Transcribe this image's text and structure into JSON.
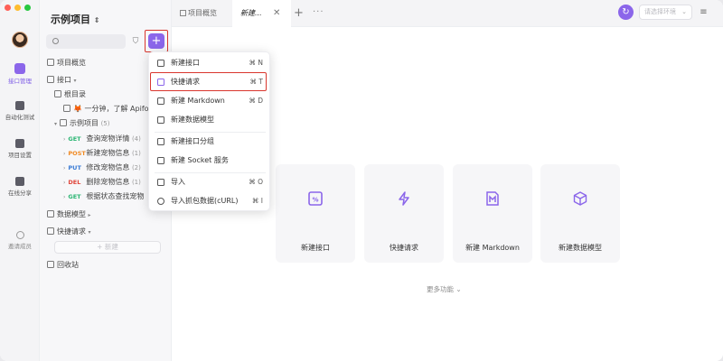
{
  "project": {
    "title": "示例项目"
  },
  "rail": {
    "items": [
      {
        "label": "接口管理",
        "active": true
      },
      {
        "label": "自动化测试"
      },
      {
        "label": "项目设置"
      },
      {
        "label": "在线分享"
      },
      {
        "label": "邀请成员"
      }
    ]
  },
  "sidebar": {
    "overview": "项目概览",
    "interfaces": "接口",
    "root": "根目录",
    "apifox_intro": "🦊 一分钟，了解 Apifox !",
    "sample_group": "示例项目",
    "sample_group_count": "(5)",
    "endpoints": [
      {
        "method": "GET",
        "name": "查询宠物详情",
        "count": "(4)"
      },
      {
        "method": "POST",
        "name": "新建宠物信息",
        "count": "(1)"
      },
      {
        "method": "PUT",
        "name": "修改宠物信息",
        "count": "(2)"
      },
      {
        "method": "DEL",
        "name": "删除宠物信息",
        "count": "(1)"
      },
      {
        "method": "GET",
        "name": "根据状态查找宠物",
        "count": ""
      }
    ],
    "data_models": "数据模型",
    "quick_requests": "快捷请求",
    "new_button": "+ 新建",
    "trash": "回收站"
  },
  "tabs": [
    {
      "label": "项目概览"
    },
    {
      "label": "新建...",
      "active": true
    }
  ],
  "toolbar": {
    "env_placeholder": "请选择环境"
  },
  "dropdown": {
    "items": [
      {
        "label": "新建接口",
        "shortcut": "⌘ N"
      },
      {
        "label": "快捷请求",
        "shortcut": "⌘ T",
        "highlighted": true
      },
      {
        "label": "新建 Markdown",
        "shortcut": "⌘ D"
      },
      {
        "label": "新建数据模型",
        "shortcut": ""
      },
      {
        "label": "新建接口分组",
        "shortcut": ""
      },
      {
        "label": "新建 Socket 服务",
        "shortcut": ""
      },
      {
        "label": "导入",
        "shortcut": "⌘ O"
      },
      {
        "label": "导入抓包数据(cURL)",
        "shortcut": "⌘ I"
      }
    ]
  },
  "cards": [
    {
      "label": "新建接口",
      "icon": "api-icon"
    },
    {
      "label": "快捷请求",
      "icon": "lightning-icon"
    },
    {
      "label": "新建 Markdown",
      "icon": "markdown-icon"
    },
    {
      "label": "新建数据模型",
      "icon": "cube-icon"
    }
  ],
  "more_features": "更多功能",
  "colors": {
    "accent": "#8b66ea",
    "highlight_border": "#d9362e",
    "method_get": "#2bb673",
    "method_post": "#f08a24",
    "method_put": "#3a7bd5",
    "method_del": "#e0453a"
  }
}
